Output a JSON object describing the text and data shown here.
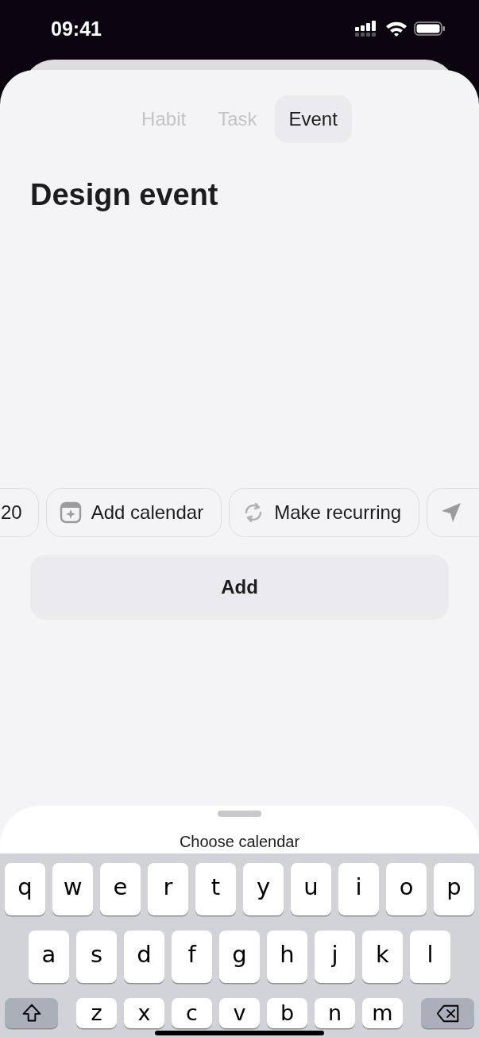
{
  "status_bar": {
    "time": "09:41"
  },
  "tabs": [
    {
      "label": "Habit",
      "selected": false
    },
    {
      "label": "Task",
      "selected": false
    },
    {
      "label": "Event",
      "selected": true
    }
  ],
  "title": "Design event",
  "chips": [
    {
      "kind": "text",
      "label": "20"
    },
    {
      "kind": "calendar",
      "label": "Add calendar"
    },
    {
      "kind": "recurring",
      "label": "Make recurring"
    },
    {
      "kind": "location"
    }
  ],
  "add_button": {
    "label": "Add"
  },
  "sheet": {
    "title": "Choose calendar"
  },
  "keyboard": {
    "rows": [
      [
        {
          "kind": "letter",
          "label": "q"
        },
        {
          "kind": "letter",
          "label": "w"
        },
        {
          "kind": "letter",
          "label": "e"
        },
        {
          "kind": "letter",
          "label": "r"
        },
        {
          "kind": "letter",
          "label": "t"
        },
        {
          "kind": "letter",
          "label": "y"
        },
        {
          "kind": "letter",
          "label": "u"
        },
        {
          "kind": "letter",
          "label": "i"
        },
        {
          "kind": "letter",
          "label": "o"
        },
        {
          "kind": "letter",
          "label": "p"
        }
      ],
      [
        {
          "kind": "letter",
          "label": "a"
        },
        {
          "kind": "letter",
          "label": "s"
        },
        {
          "kind": "letter",
          "label": "d"
        },
        {
          "kind": "letter",
          "label": "f"
        },
        {
          "kind": "letter",
          "label": "g"
        },
        {
          "kind": "letter",
          "label": "h"
        },
        {
          "kind": "letter",
          "label": "j"
        },
        {
          "kind": "letter",
          "label": "k"
        },
        {
          "kind": "letter",
          "label": "l"
        }
      ],
      [
        {
          "kind": "shift"
        },
        {
          "kind": "letter",
          "label": "z"
        },
        {
          "kind": "letter",
          "label": "x"
        },
        {
          "kind": "letter",
          "label": "c"
        },
        {
          "kind": "letter",
          "label": "v"
        },
        {
          "kind": "letter",
          "label": "b"
        },
        {
          "kind": "letter",
          "label": "n"
        },
        {
          "kind": "letter",
          "label": "m"
        },
        {
          "kind": "delete"
        }
      ]
    ]
  }
}
